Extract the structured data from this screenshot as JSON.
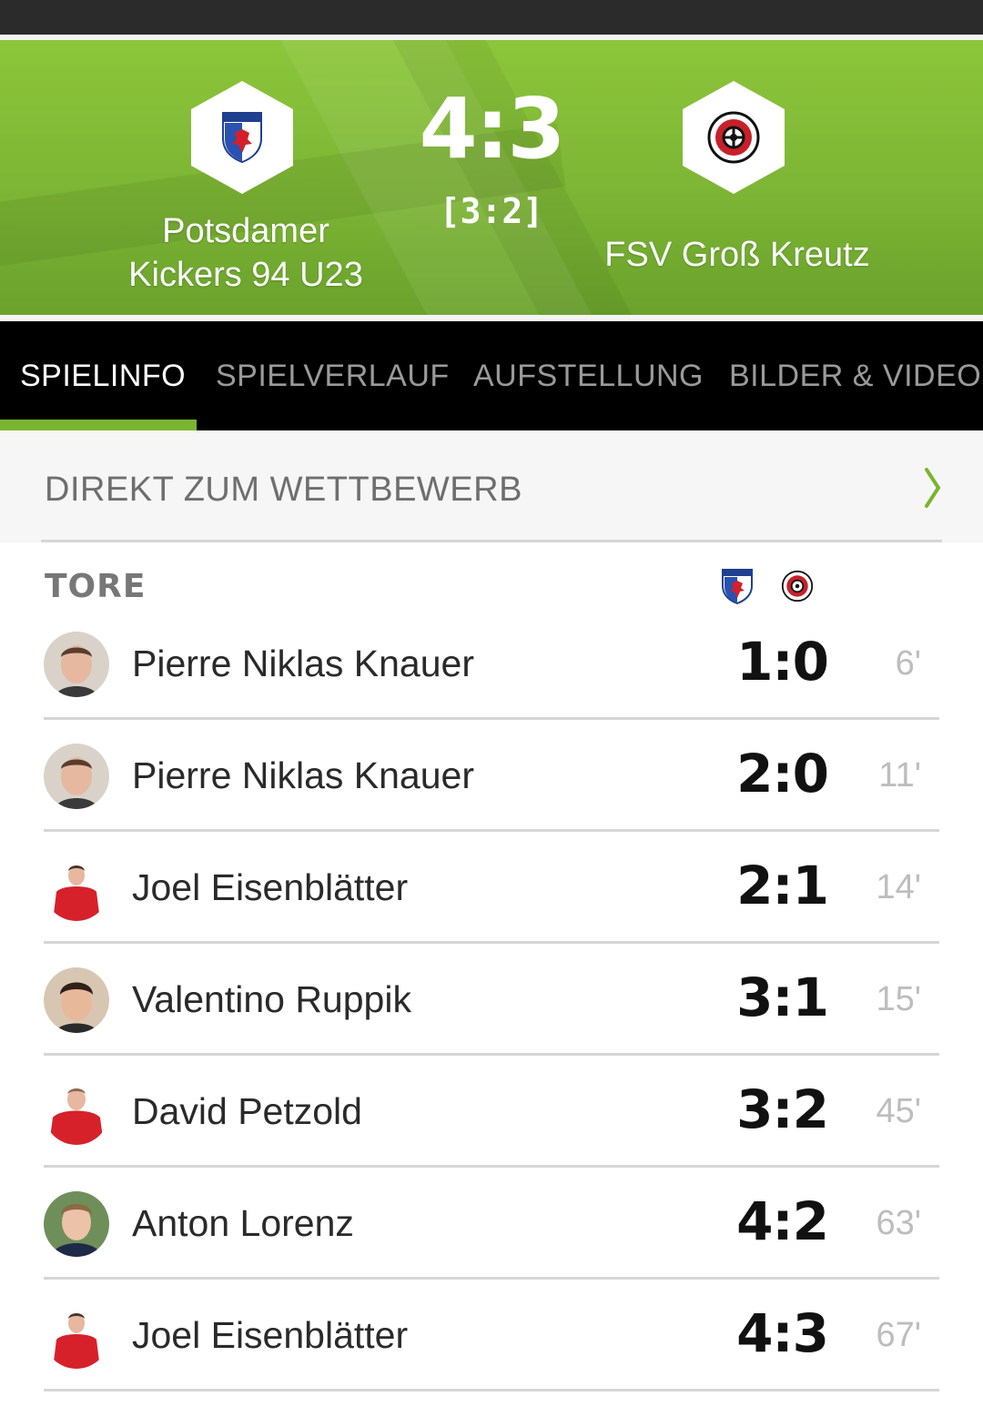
{
  "match": {
    "home_team": "Potsdamer Kickers 94 U23",
    "away_team": "FSV Groß Kreutz",
    "score": "4:3",
    "halftime": "[3:2]"
  },
  "tabs": [
    {
      "label": "SPIELINFO",
      "active": true
    },
    {
      "label": "SPIELVERLAUF",
      "active": false
    },
    {
      "label": "AUFSTELLUNG",
      "active": false
    },
    {
      "label": "BILDER & VIDEOS",
      "active": false
    }
  ],
  "competition": {
    "label": "DIREKT ZUM WETTBEWERB"
  },
  "goals": {
    "title": "TORE",
    "rows": [
      {
        "player": "Pierre Niklas Knauer",
        "score": "1:0",
        "minute": "6'"
      },
      {
        "player": "Pierre Niklas Knauer",
        "score": "2:0",
        "minute": "11'"
      },
      {
        "player": "Joel Eisenblätter",
        "score": "2:1",
        "minute": "14'"
      },
      {
        "player": "Valentino Ruppik",
        "score": "3:1",
        "minute": "15'"
      },
      {
        "player": "David Petzold",
        "score": "3:2",
        "minute": "45'"
      },
      {
        "player": "Anton Lorenz",
        "score": "4:2",
        "minute": "63'"
      },
      {
        "player": "Joel Eisenblätter",
        "score": "4:3",
        "minute": "67'"
      }
    ]
  },
  "colors": {
    "accent_green": "#79b530",
    "hero_green": "#8cc63a",
    "tab_bar": "#000000"
  }
}
